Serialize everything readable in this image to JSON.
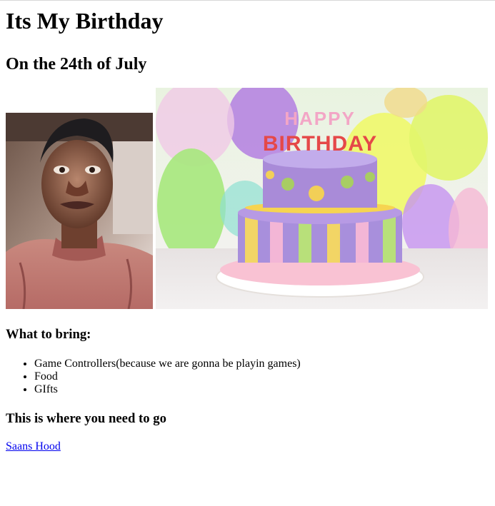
{
  "header": {
    "title": "Its My Birthday",
    "subtitle": "On the 24th of July"
  },
  "images": {
    "portrait": "portrait-photo",
    "cake": "birthday-cake-photo",
    "cake_topper": "HAPPY BIRTHDAY"
  },
  "bring": {
    "heading": "What to bring:",
    "items": [
      "Game Controllers(because we are gonna be playin games)",
      "Food",
      "GIfts"
    ]
  },
  "location": {
    "heading": "This is where you need to go",
    "link_text": "Saans Hood"
  }
}
